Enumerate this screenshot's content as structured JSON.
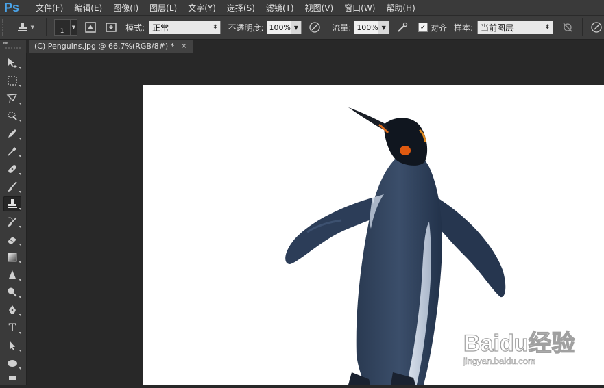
{
  "app": {
    "logo": "Ps"
  },
  "menu": [
    "文件(F)",
    "编辑(E)",
    "图像(I)",
    "图层(L)",
    "文字(Y)",
    "选择(S)",
    "滤镜(T)",
    "视图(V)",
    "窗口(W)",
    "帮助(H)"
  ],
  "options": {
    "brush_size": "1",
    "mode_label": "模式:",
    "mode_value": "正常",
    "opacity_label": "不透明度:",
    "opacity_value": "100%",
    "flow_label": "流量:",
    "flow_value": "100%",
    "aligned_label": "对齐",
    "aligned_checked": true,
    "sample_label": "样本:",
    "sample_value": "当前图层"
  },
  "document": {
    "tab_title": "(C) Penguins.jpg @ 66.7%(RGB/8#) *",
    "close_glyph": "×"
  },
  "toolbox": {
    "head": "▸▸",
    "tools": [
      "move-tool",
      "marquee-tool",
      "lasso-tool",
      "quick-select-tool",
      "crop-tool",
      "eyedropper-tool",
      "healing-brush-tool",
      "brush-tool",
      "clone-stamp-tool",
      "history-brush-tool",
      "eraser-tool",
      "gradient-tool",
      "blur-tool",
      "dodge-tool",
      "pen-tool",
      "type-tool",
      "path-select-tool",
      "ellipse-tool",
      "hand-tool"
    ],
    "active": "clone-stamp-tool",
    "type_glyph": "T"
  },
  "watermark": {
    "brand": "Baidu经验",
    "url": "jingyan.baidu.com"
  },
  "colors": {
    "accent": "#4aa3e8",
    "panel": "#3a3a3a",
    "workspace": "#282828"
  }
}
